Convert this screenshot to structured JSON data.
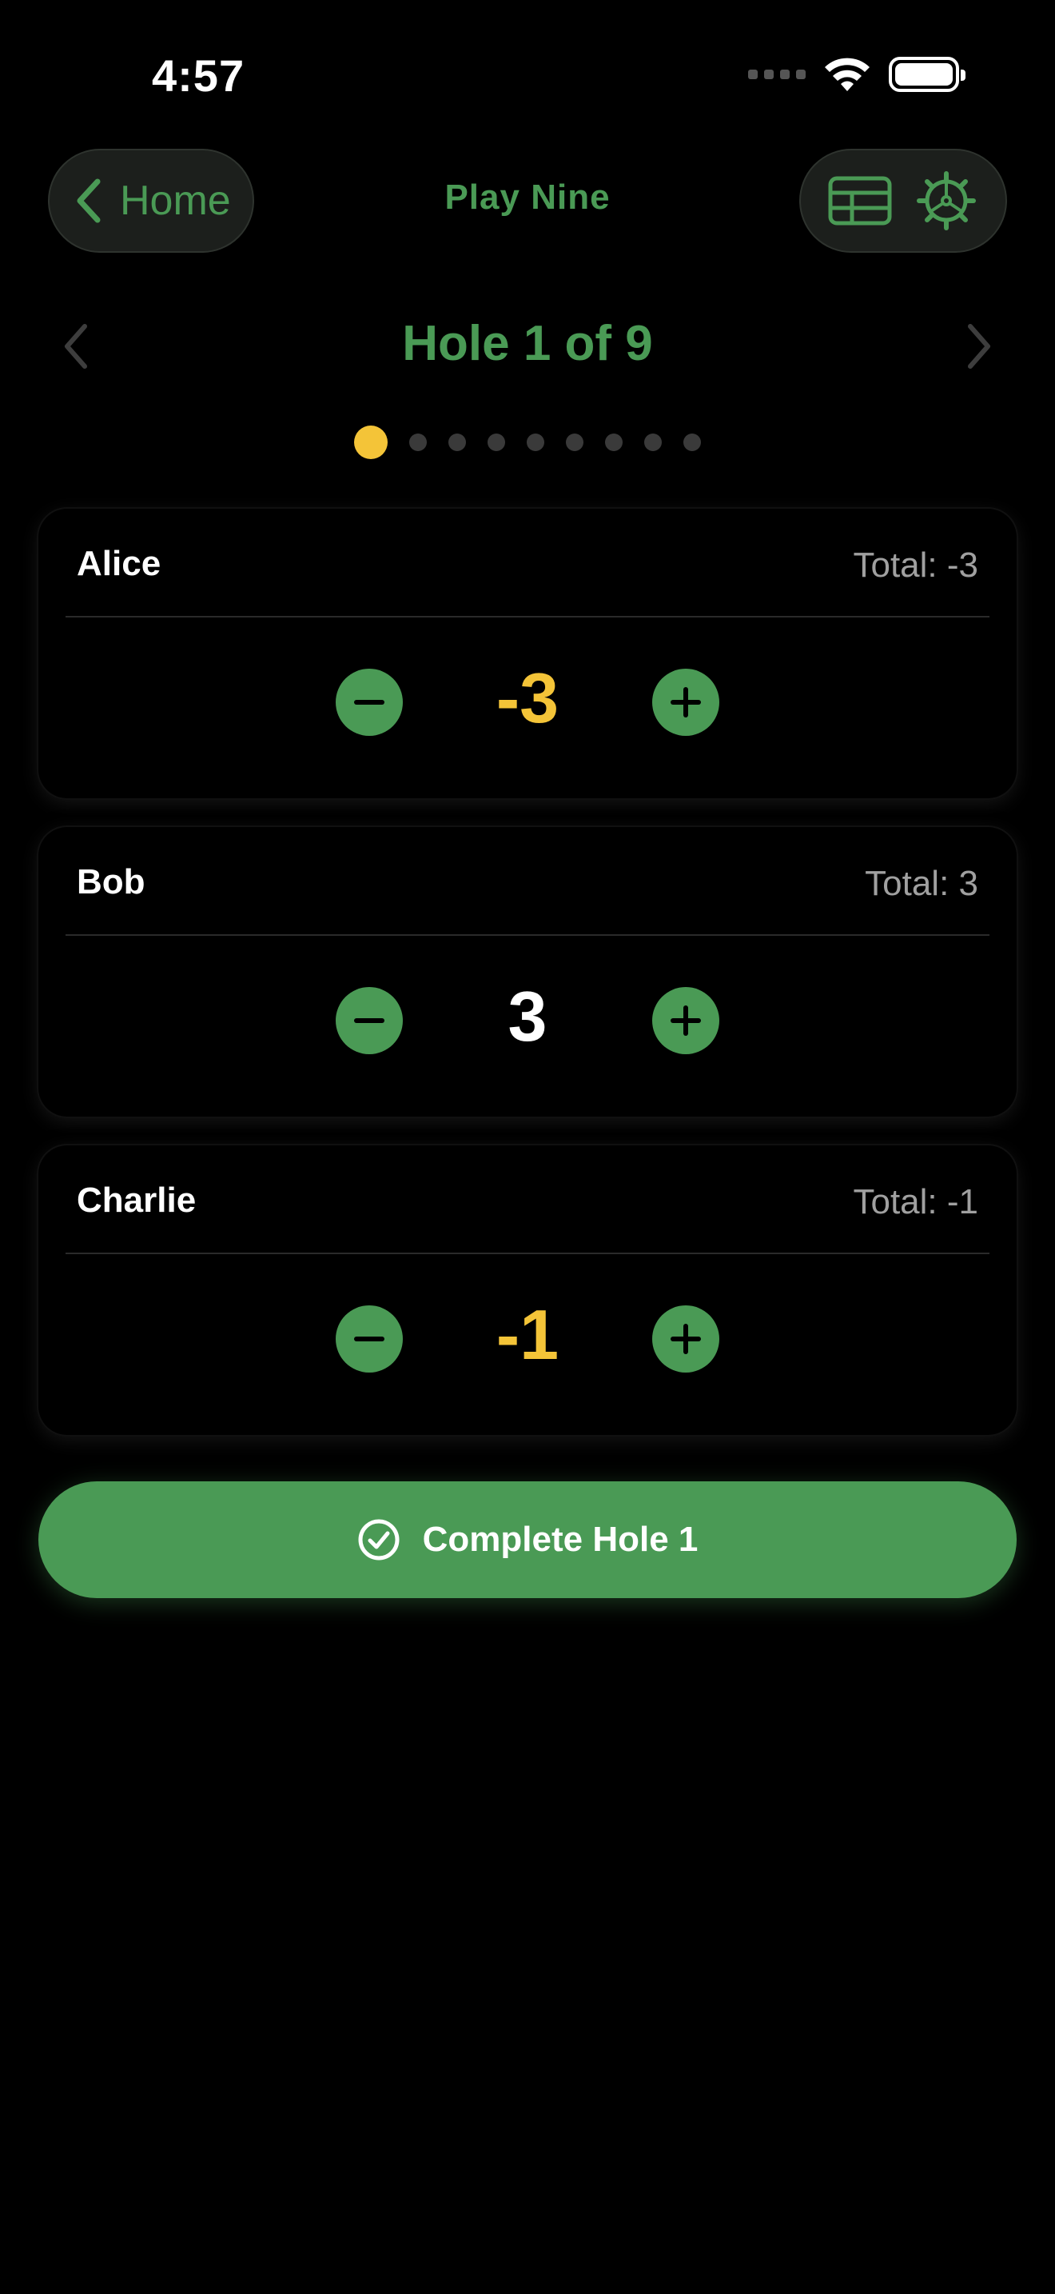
{
  "status_bar": {
    "time": "4:57"
  },
  "nav": {
    "back_label": "Home",
    "title": "Play Nine"
  },
  "hole": {
    "title": "Hole 1 of 9",
    "current": 1,
    "total": 9
  },
  "players": [
    {
      "name": "Alice",
      "total": "Total: -3",
      "score": "-3",
      "score_color": "#f4c438"
    },
    {
      "name": "Bob",
      "total": "Total: 3",
      "score": "3",
      "score_color": "#ffffff"
    },
    {
      "name": "Charlie",
      "total": "Total: -1",
      "score": "-1",
      "score_color": "#f4c438"
    }
  ],
  "complete_button": {
    "label": "Complete Hole 1"
  },
  "colors": {
    "accent_green": "#4a9a55",
    "accent_yellow": "#f4c438",
    "background": "#000000"
  },
  "icons": {
    "back": "chevron-left-icon",
    "scorecard": "table-grid-icon",
    "settings": "gear-icon",
    "decrement": "minus-icon",
    "increment": "plus-icon",
    "complete": "checkmark-circle-icon"
  }
}
